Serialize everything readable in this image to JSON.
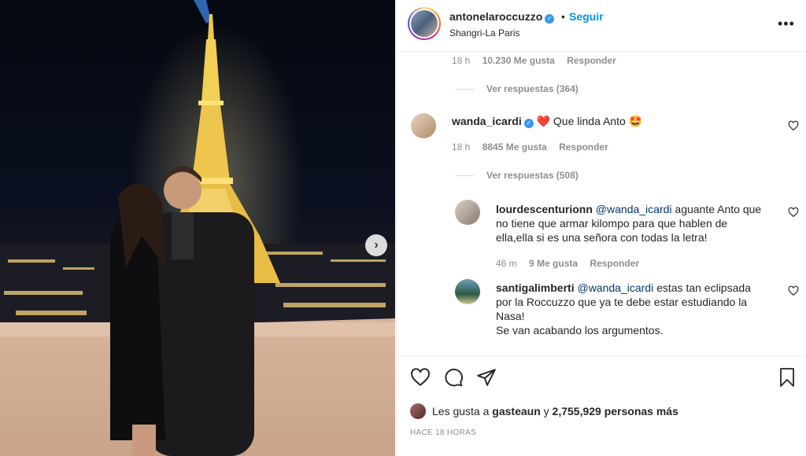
{
  "post": {
    "username": "antonelaroccuzzo",
    "verified_mark": "✓",
    "dot": "•",
    "follow_label": "Seguir",
    "location": "Shangri-La Paris",
    "more_icon": "•••"
  },
  "photo": {
    "next_icon": "›"
  },
  "top_meta": {
    "time": "18 h",
    "likes": "10.230 Me gusta",
    "reply": "Responder"
  },
  "top_replies": "Ver respuestas (364)",
  "comments": [
    {
      "username": "wanda_icardi",
      "verified_mark": "✓",
      "text": "Que linda Anto",
      "emoji": "❤️",
      "emoji2": "🤩",
      "time": "18 h",
      "likes": "8845 Me gusta",
      "reply": "Responder",
      "replies": "Ver respuestas (508)"
    },
    {
      "username": "lourdescenturionn",
      "mention": "@wanda_icardi",
      "text_line1": " aguante Anto que",
      "text_line2": "no tiene que armar kilompo para que hablen de",
      "text_line3": "ella,ella si es una señora con todas la letra!",
      "time": "46 m",
      "likes": "9 Me gusta",
      "reply": "Responder"
    },
    {
      "username": "santigalimberti",
      "mention": "@wanda_icardi",
      "text_line1": " estas tan eclipsada",
      "text_line2": "por la Roccuzzo que ya te debe estar estudiando la",
      "text_line3": "Nasa!",
      "text_line4": "Se van acabando los argumentos."
    }
  ],
  "footer": {
    "likes_prefix": "Les gusta a ",
    "likes_user": "gasteaun",
    "likes_mid": " y ",
    "likes_count": "2,755,929 personas más",
    "time_ago": "HACE 18 HORAS"
  },
  "icons": {
    "like": "heart-icon",
    "comment": "comment-icon",
    "share": "share-icon",
    "save": "bookmark-icon"
  }
}
